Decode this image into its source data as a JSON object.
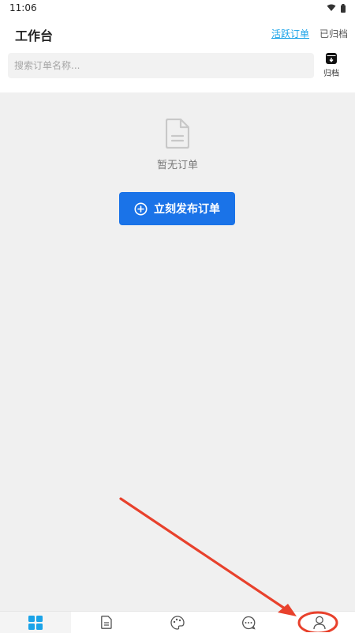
{
  "status_bar": {
    "time": "11:06"
  },
  "header": {
    "title": "工作台",
    "tabs": [
      {
        "label": "活跃订单",
        "active": true
      },
      {
        "label": "已归档",
        "active": false
      }
    ]
  },
  "search": {
    "placeholder": "搜索订单名称..."
  },
  "archive_button": {
    "label": "归档",
    "icon": "archive-box-icon"
  },
  "empty_state": {
    "icon": "document-icon",
    "message": "暂无订单",
    "button_label": "立刻发布订单",
    "button_icon": "plus-circle-icon"
  },
  "bottom_nav": [
    {
      "icon": "grid-icon",
      "active": true
    },
    {
      "icon": "document-icon",
      "active": false
    },
    {
      "icon": "palette-icon",
      "active": false
    },
    {
      "icon": "chat-bubble-icon",
      "active": false
    },
    {
      "icon": "user-icon",
      "active": false
    }
  ],
  "colors": {
    "accent": "#1a73e8",
    "tab_active": "#1aa3e8",
    "annotation": "#e8412c"
  }
}
